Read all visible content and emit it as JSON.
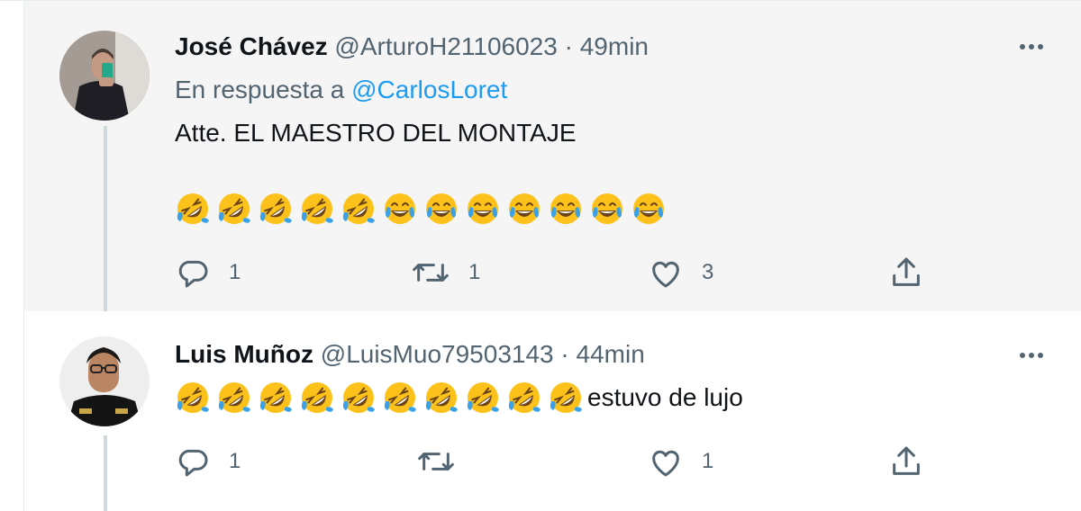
{
  "tweets": [
    {
      "name": "José Chávez",
      "handle": "@ArturoH21106023",
      "separator": "·",
      "time": "49min",
      "reply_prefix": "En respuesta a",
      "reply_mention": "@CarlosLoret",
      "text": "Atte. EL MAESTRO DEL MONTAJE",
      "emojis": [
        "rolling-on-floor-laughing",
        "rolling-on-floor-laughing",
        "rolling-on-floor-laughing",
        "rolling-on-floor-laughing",
        "rolling-on-floor-laughing",
        "tears-of-joy",
        "tears-of-joy",
        "tears-of-joy",
        "tears-of-joy",
        "tears-of-joy",
        "tears-of-joy",
        "tears-of-joy"
      ],
      "emoji_text": "",
      "actions": {
        "reply_count": "1",
        "retweet_count": "1",
        "like_count": "3",
        "share_count": ""
      },
      "background": "#f5f5f5"
    },
    {
      "name": "Luis Muñoz",
      "handle": "@LuisMuo79503143",
      "separator": "·",
      "time": "44min",
      "emojis": [
        "rolling-on-floor-laughing",
        "rolling-on-floor-laughing",
        "rolling-on-floor-laughing",
        "rolling-on-floor-laughing",
        "rolling-on-floor-laughing",
        "rolling-on-floor-laughing",
        "rolling-on-floor-laughing",
        "rolling-on-floor-laughing",
        "rolling-on-floor-laughing",
        "rolling-on-floor-laughing"
      ],
      "emoji_text": "estuvo de lujo",
      "actions": {
        "reply_count": "1",
        "retweet_count": "",
        "like_count": "1",
        "share_count": ""
      },
      "background": "#ffffff"
    }
  ],
  "colors": {
    "name": "#0f1419",
    "secondary": "#536471",
    "mention": "#1d9bf0",
    "thread_line": "#cfd9de",
    "emoji_face": "#fcc21b",
    "emoji_tear": "#3aa0e8"
  },
  "icons": {
    "more": "more-icon",
    "reply": "reply-icon",
    "retweet": "retweet-icon",
    "like": "like-icon",
    "share": "share-icon"
  }
}
